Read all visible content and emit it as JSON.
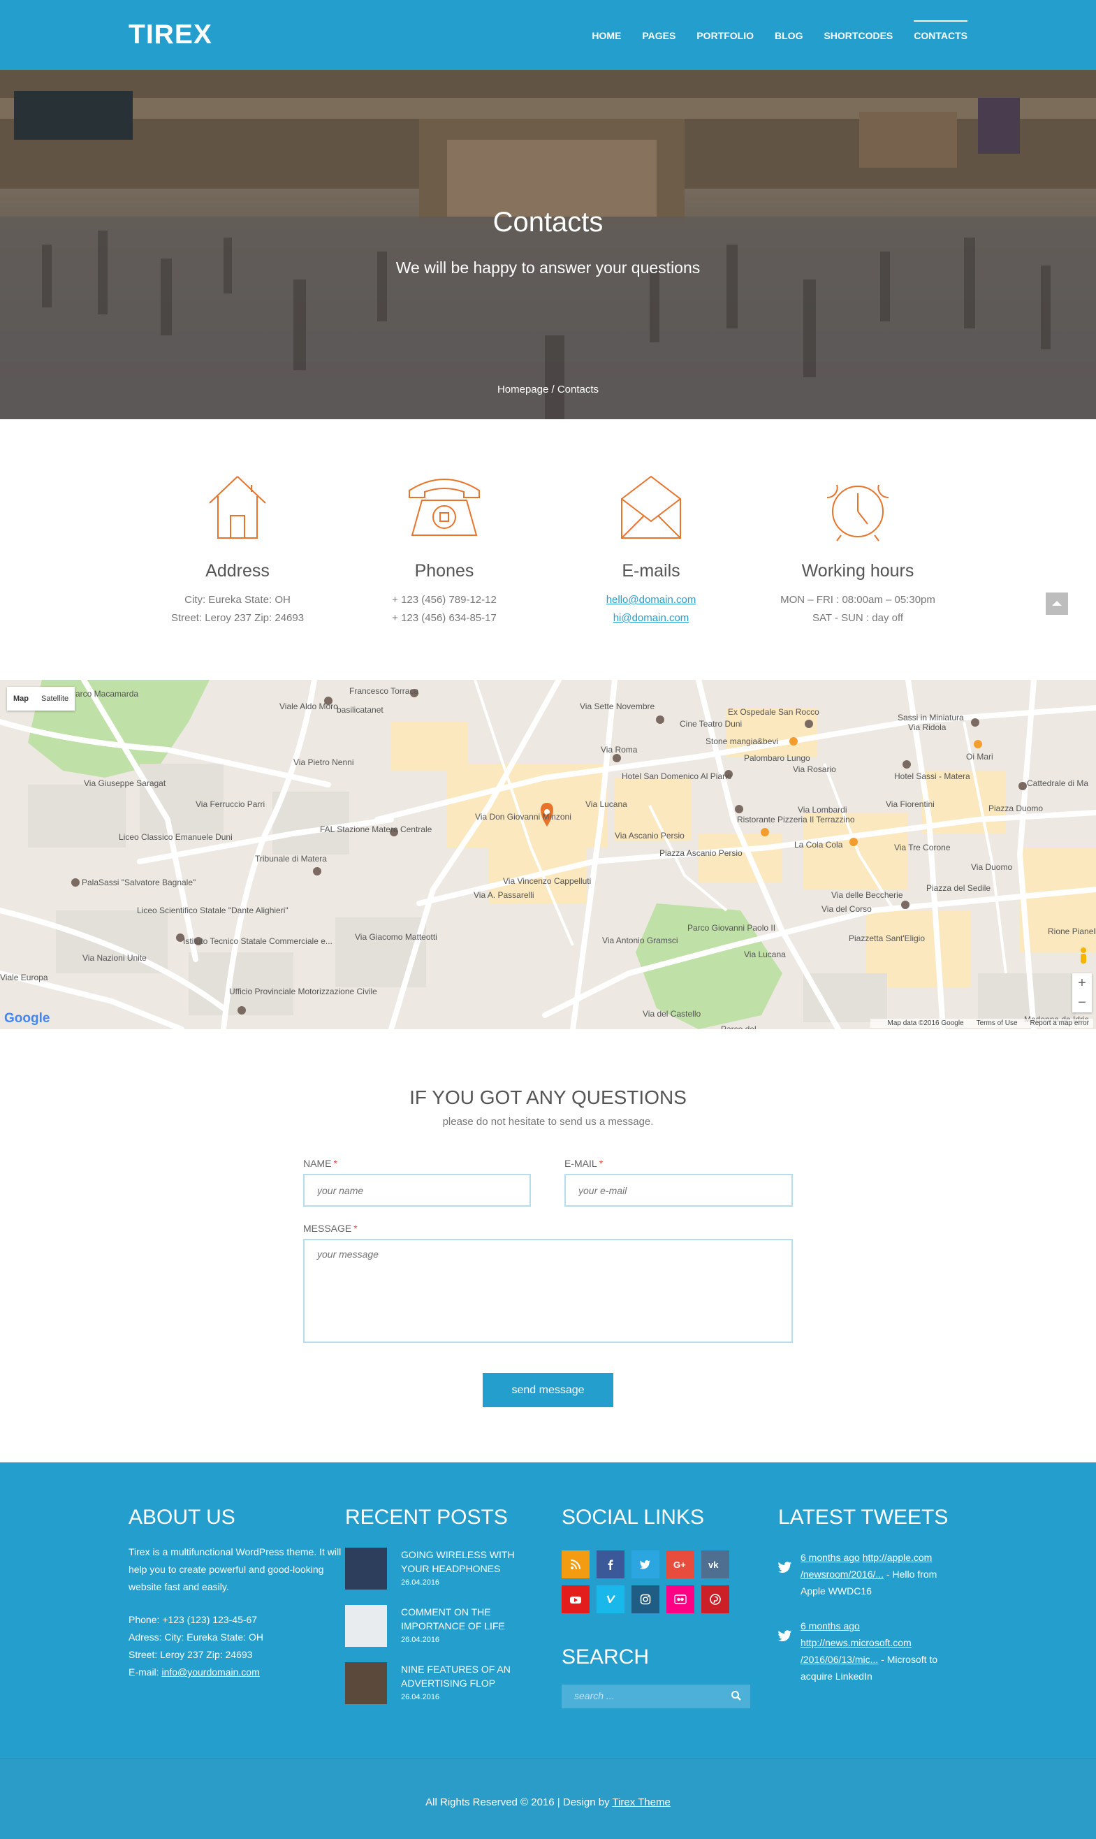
{
  "header": {
    "logo": "TIREX",
    "nav": [
      "HOME",
      "PAGES",
      "PORTFOLIO",
      "BLOG",
      "SHORTCODES",
      "CONTACTS"
    ],
    "active_nav": "CONTACTS"
  },
  "hero": {
    "title": "Contacts",
    "subtitle": "We will be happy to answer your questions",
    "breadcrumb_home": "Homepage",
    "breadcrumb_sep": " / ",
    "breadcrumb_current": "Contacts"
  },
  "info": [
    {
      "icon": "house-icon",
      "title": "Address",
      "lines": [
        "City: Eureka State: OH",
        "Street: Leroy 237 Zip: 24693"
      ]
    },
    {
      "icon": "telephone-icon",
      "title": "Phones",
      "lines": [
        "+ 123 (456) 789-12-12",
        "+ 123 (456) 634-85-17"
      ]
    },
    {
      "icon": "envelope-icon",
      "title": "E-mails",
      "lines": [
        "hello@domain.com",
        "hi@domain.com"
      ]
    },
    {
      "icon": "alarm-clock-icon",
      "title": "Working hours",
      "lines": [
        "MON – FRI : 08:00am – 05:30pm",
        "SAT - SUN : day off"
      ]
    }
  ],
  "map": {
    "toggle": [
      "Map",
      "Satellite"
    ],
    "logo": "Google",
    "attribution": [
      "Map data ©2016 Google",
      "Terms of Use",
      "Report a map error"
    ],
    "labels": [
      "Parco Macamarda",
      "basilicatanet",
      "Francesco Torraca",
      "Via Sette Novembre",
      "Ex Ospedale San Rocco",
      "Sassi in Miniatura",
      "Cine Teatro Duni",
      "Stone mangia&bevi",
      "Oi Mari",
      "Via Roma",
      "Palombaro Lungo",
      "Hotel San Domenico Al Piano",
      "Via Rosario",
      "Hotel Sassi - Matera",
      "Cattedrale di Ma",
      "Via Giuseppe Saragat",
      "Via Lucana",
      "Via Don Giovanni Minzoni",
      "Piazza Duomo",
      "Liceo Classico Emanuele Duni",
      "FAL Stazione Matera Centrale",
      "Ristorante Pizzeria Il Terrazzino",
      "Via Lombardi",
      "Via Fiorentini",
      "Tribunale di Matera",
      "Via Ascanio Persio",
      "La Cola Cola",
      "Via Tre Corone",
      "Piazza Ascanio Persio",
      "PalaSassi \"Salvatore Bagnale\"",
      "Via Vincenzo Cappelluti",
      "Via delle Beccherie",
      "Via Duomo",
      "Liceo Scientifico Statale \"Dante Alighieri\"",
      "Via A. Passarelli",
      "Piazza del Sedile",
      "Via del Corso",
      "Istituto Tecnico Statale Commerciale e...",
      "Via Antonio Gramsci",
      "Parco Giovanni Paolo II",
      "Piazzetta Sant'Eligio",
      "Via Lucana",
      "Via Nazioni Unite",
      "Viale Europa",
      "Ufficio Provinciale Motorizzazione Civile",
      "Via del Castello",
      "Via Ridola",
      "Parco del",
      "Madonna de Idris",
      "Rione Pianelle",
      "Viale Aldo Moro",
      "Via Pietro Nenni",
      "Via Giacomo Matteotti",
      "Via Ferruccio Parri"
    ]
  },
  "form": {
    "title": "IF YOU GOT ANY QUESTIONS",
    "subtitle": "please do not hesitate to send us a message.",
    "name_label": "NAME",
    "name_placeholder": "your name",
    "email_label": "E-MAIL",
    "email_placeholder": "your e-mail",
    "message_label": "MESSAGE",
    "message_placeholder": "your message",
    "required_mark": "*",
    "submit": "send message"
  },
  "footer": {
    "about": {
      "title": "ABOUT US",
      "text": "Tirex is a multifunctional WordPress theme. It will help you to create powerful and good-looking website fast and easily.",
      "phone": "Phone: +123 (123) 123-45-67",
      "address": "Adress: City: Eureka State: OH",
      "street": "Street: Leroy 237 Zip: 24693",
      "email_label": "E-mail: ",
      "email": "info@yourdomain.com"
    },
    "posts": {
      "title": "RECENT POSTS",
      "items": [
        {
          "title": "GOING WIRELESS WITH YOUR HEADPHONES",
          "date": "26.04.2016"
        },
        {
          "title": "COMMENT ON THE IMPORTANCE OF LIFE",
          "date": "26.04.2016"
        },
        {
          "title": "NINE FEATURES OF AN ADVERTISING FLOP",
          "date": "26.04.2016"
        }
      ]
    },
    "social": {
      "title": "SOCIAL LINKS",
      "items": [
        {
          "icon": "rss-icon",
          "color": "#f39c12"
        },
        {
          "icon": "facebook-icon",
          "color": "#3b5998"
        },
        {
          "icon": "twitter-icon",
          "color": "#2ba6e1"
        },
        {
          "icon": "google-plus-icon",
          "color": "#e74c3c"
        },
        {
          "icon": "vk-icon",
          "color": "#4f6f91"
        },
        {
          "icon": "youtube-icon",
          "color": "#e31c1c"
        },
        {
          "icon": "vimeo-icon",
          "color": "#1ab7ea"
        },
        {
          "icon": "instagram-icon",
          "color": "#1f5d85"
        },
        {
          "icon": "flickr-icon",
          "color": "#ff0084"
        },
        {
          "icon": "pinterest-icon",
          "color": "#cb2027"
        }
      ]
    },
    "search": {
      "title": "SEARCH",
      "placeholder": "search ..."
    },
    "tweets": {
      "title": "LATEST TWEETS",
      "items": [
        {
          "time": "6 months ago",
          "link": "http://apple.com /newsroom/2016/...",
          "text": " - Hello from Apple WWDC16"
        },
        {
          "time": "6 months ago",
          "link": "http://news.microsoft.com /2016/06/13/mic...",
          "text": " - Microsoft to acquire LinkedIn"
        }
      ]
    }
  },
  "copyright": {
    "text": "All Rights Reserved © 2016 | Design by ",
    "link": "Tirex Theme"
  },
  "colors": {
    "brand": "#249ecd",
    "accent": "#e8742c",
    "field_border": "#b7dcec"
  }
}
